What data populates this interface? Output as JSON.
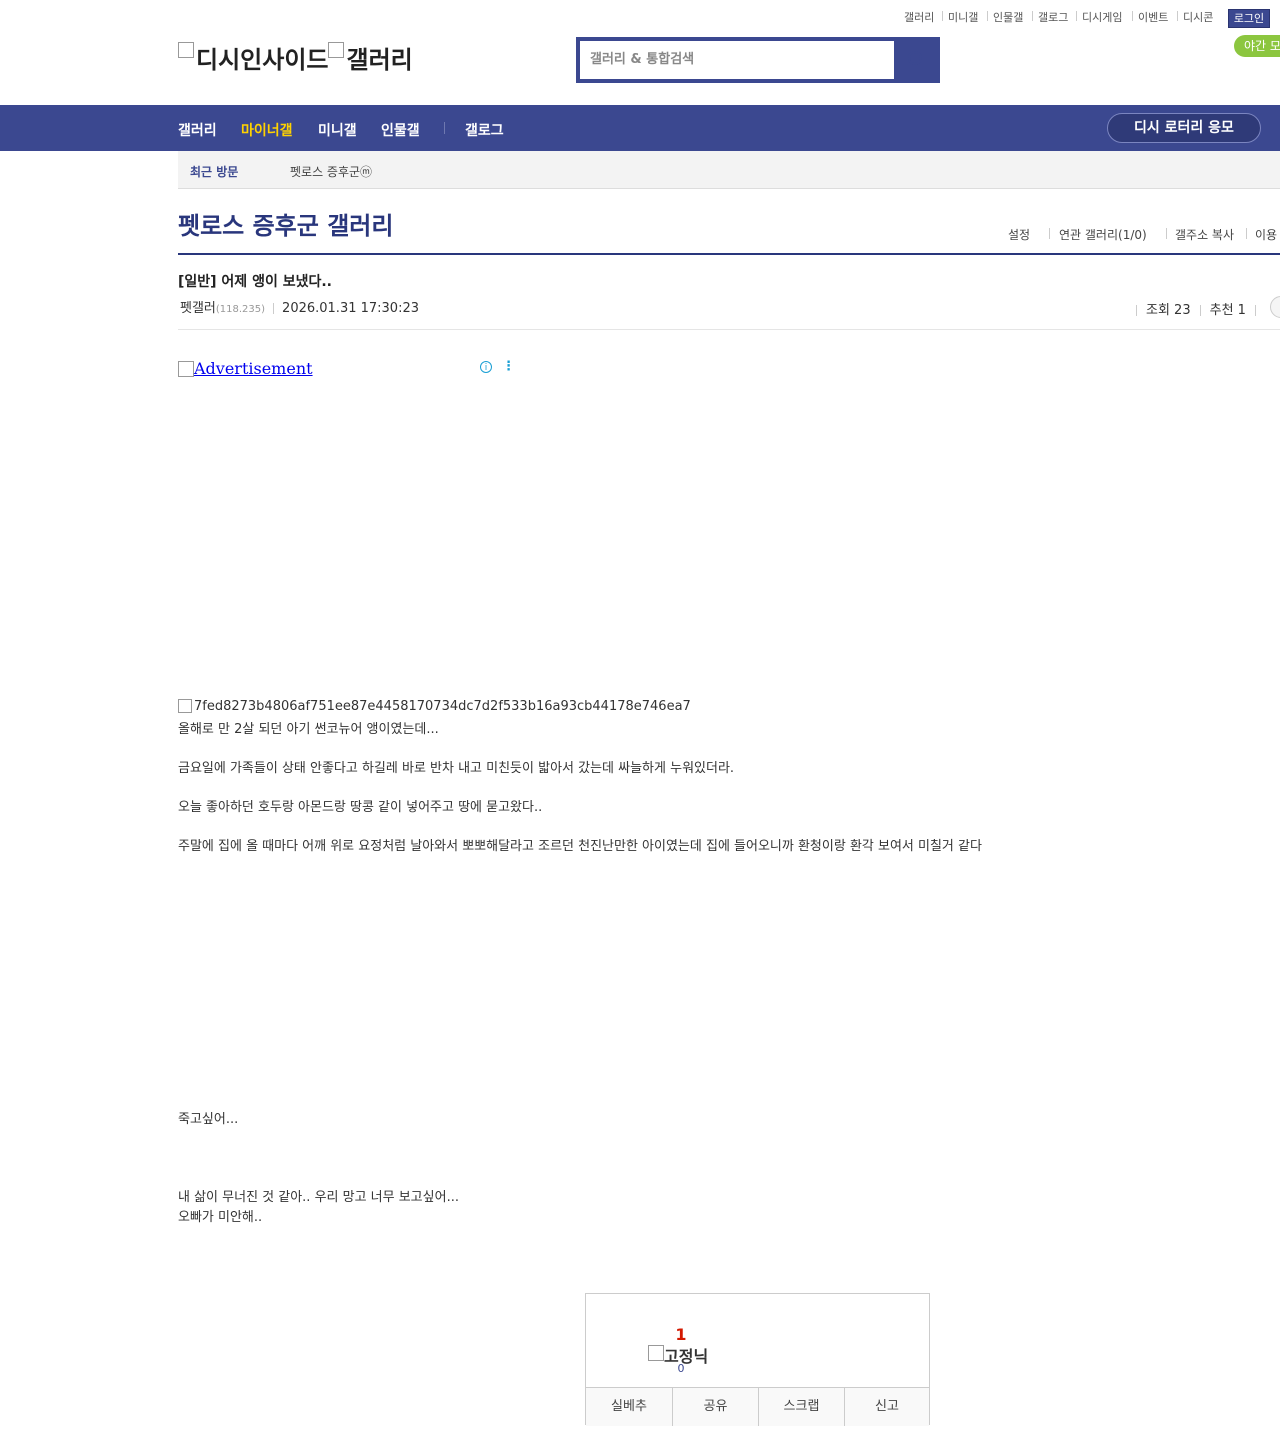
{
  "top_links": [
    "갤러리",
    "미니갤",
    "인물갤",
    "갤로그",
    "디시게임",
    "이벤트",
    "디시콘"
  ],
  "login": "로그인",
  "night_mode": "야간 모",
  "logo": {
    "site": "디시인사이드",
    "section": "갤러리"
  },
  "search": {
    "placeholder": "갤러리 & 통합검색"
  },
  "nav": {
    "items": [
      "갤러리",
      "마이너갤",
      "미니갤",
      "인물갤",
      "갤로그"
    ],
    "lotto": "디시 로터리 응모"
  },
  "recent": {
    "label": "최근 방문",
    "item": "펫로스 증후군ⓜ"
  },
  "gallery": {
    "title": "펫로스 증후군 갤러리",
    "menu": [
      "설정",
      "연관 갤러리(1/0)",
      "갤주소 복사",
      "이용"
    ]
  },
  "post": {
    "title": "[일반] 어제 앵이 보냈다..",
    "author": "펫갤러",
    "ip": "(118.235)",
    "datetime": "2026.01.31 17:30:23",
    "views": "조회 23",
    "recommend": "추천 1"
  },
  "ad": {
    "alt": "Advertisement",
    "info_icon": "info-icon",
    "more_icon": "more-vertical-icon"
  },
  "content": {
    "image_alt": "7fed8273b4806af751ee87e4458170734dc7d2f533b16a93cb44178e746ea7",
    "paragraphs": [
      "올해로 만 2살 되던 아기 썬코뉴어 앵이였는데...",
      "금요일에 가족들이 상태 안좋다고 하길레 바로 반차 내고 미친듯이 밟아서 갔는데 싸늘하게 누워있더라.",
      "오늘 좋아하던 호두랑 아몬드랑 땅콩 같이 넣어주고 땅에 묻고왔다..",
      "주말에 집에 올 때마다 어깨 위로 요정처럼 날아와서 뽀뽀해달라고 조르던 천진난만한 아이였는데 집에 들어오니까 환청이랑 환각 보여서 미칠거 같다",
      "죽고싶어...",
      "내 삶이 무너진 것 같아.. 우리 망고 너무 보고싶어...",
      "오빠가 미안해.."
    ]
  },
  "recommend_box": {
    "up_count": "1",
    "fixed_nick_alt": "고정닉",
    "fixed_count": "0",
    "buttons": [
      "실베추",
      "공유",
      "스크랩",
      "신고"
    ]
  },
  "colors": {
    "brand": "#3b4890",
    "title": "#29367c",
    "highlight": "#ffd200",
    "recommend": "#d31900",
    "night": "#8cc63f"
  }
}
